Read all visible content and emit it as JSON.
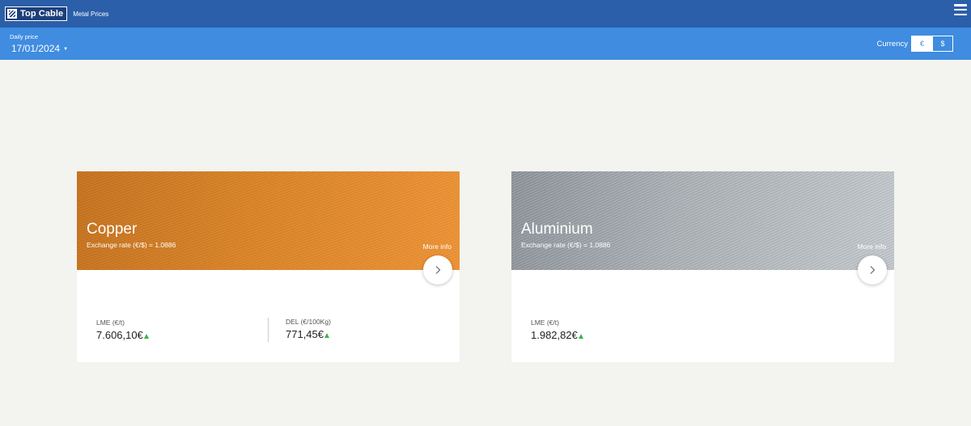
{
  "header": {
    "logo_text": "Top Cable",
    "app_title": "Metal Prices",
    "menu_icon": "hamburger-menu-icon"
  },
  "subheader": {
    "daily_label": "Daily price",
    "date": "17/01/2024",
    "currency_label": "Currency",
    "currency_options": [
      "€",
      "$"
    ],
    "selected_currency": "€"
  },
  "cards": [
    {
      "name": "Copper",
      "exchange": "Exchange rate (€/$) = 1.0886",
      "more_info": "More info",
      "values": [
        {
          "label": "LME (€/t)",
          "value": "7.606,10€",
          "trend": "up"
        },
        {
          "label": "DEL (€/100Kg)",
          "value": "771,45€",
          "trend": "up"
        }
      ]
    },
    {
      "name": "Aluminium",
      "exchange": "Exchange rate (€/$) = 1.0886",
      "more_info": "More info",
      "values": [
        {
          "label": "LME (€/t)",
          "value": "1.982,82€",
          "trend": "up"
        }
      ]
    }
  ],
  "colors": {
    "topbar": "#2b5faa",
    "subbar": "#3f8ce0",
    "trend_up": "#3bb34a",
    "background": "#f3f3ef"
  }
}
